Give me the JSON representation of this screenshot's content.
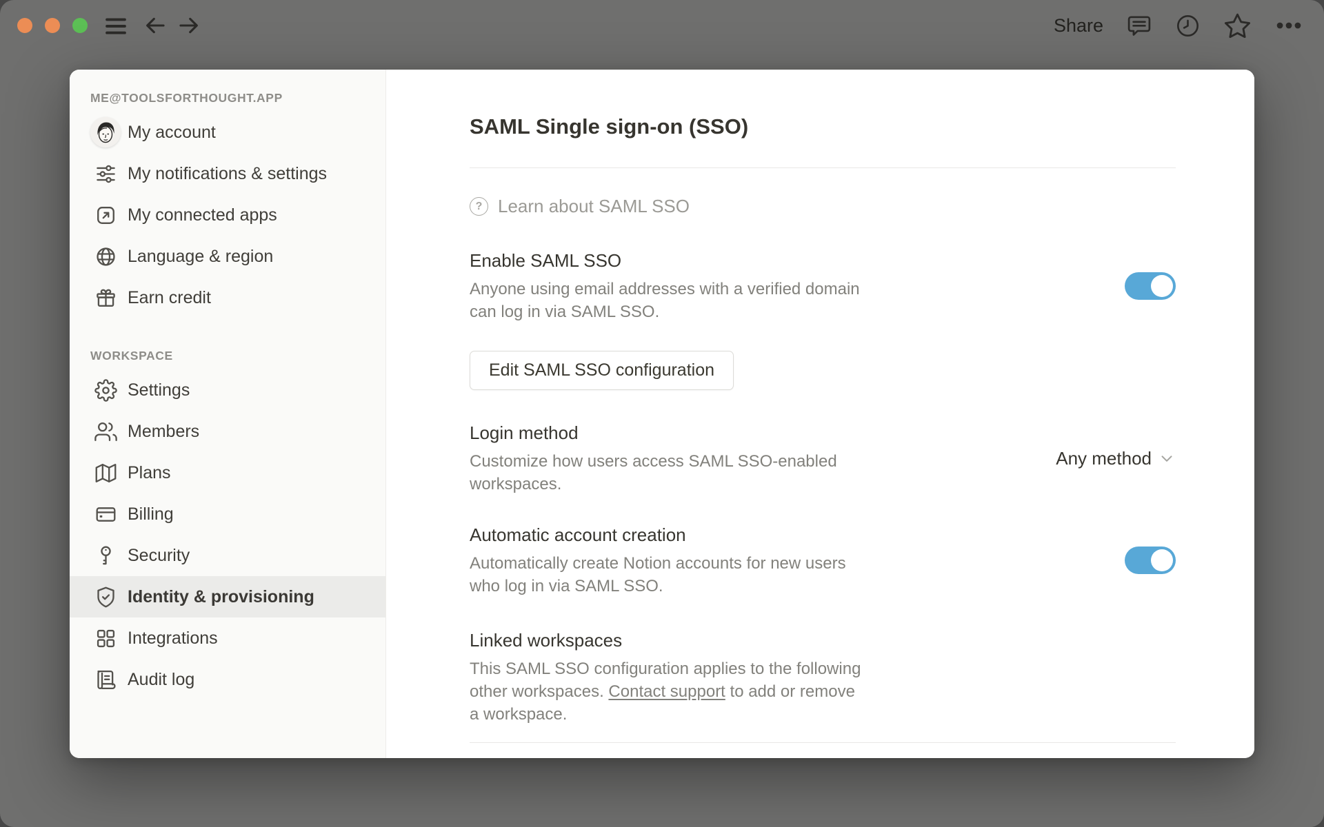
{
  "titlebar": {
    "share_label": "Share",
    "icons": {
      "traffic_close": "circle",
      "traffic_minimize": "circle",
      "traffic_zoom": "circle",
      "menu": "hamburger-lines",
      "back": "arrow-left",
      "forward": "arrow-right",
      "comments": "speech-bubble",
      "updates": "clock",
      "favorite": "star-outline",
      "more": "ellipsis"
    }
  },
  "sidebar": {
    "account_header": "ME@TOOLSFORTHOUGHT.APP",
    "account_items": [
      {
        "icon": "avatar-photo",
        "label": "My account"
      },
      {
        "icon": "sliders",
        "label": "My notifications & settings"
      },
      {
        "icon": "arrow-up-right-box",
        "label": "My connected apps"
      },
      {
        "icon": "globe",
        "label": "Language & region"
      },
      {
        "icon": "gift",
        "label": "Earn credit"
      }
    ],
    "workspace_header": "WORKSPACE",
    "workspace_items": [
      {
        "icon": "gear",
        "label": "Settings"
      },
      {
        "icon": "people",
        "label": "Members"
      },
      {
        "icon": "map",
        "label": "Plans"
      },
      {
        "icon": "credit-card",
        "label": "Billing"
      },
      {
        "icon": "key",
        "label": "Security"
      },
      {
        "icon": "shield-check",
        "label": "Identity & provisioning",
        "selected": true
      },
      {
        "icon": "grid-squares",
        "label": "Integrations"
      },
      {
        "icon": "scroll",
        "label": "Audit log"
      }
    ]
  },
  "main": {
    "title": "SAML Single sign-on (SSO)",
    "learn_icon_glyph": "?",
    "learn_link": "Learn about SAML SSO",
    "enable": {
      "heading": "Enable SAML SSO",
      "description": "Anyone using email addresses with a verified domain\ncan log in via SAML SSO.",
      "toggle_on": true
    },
    "edit_button_label": "Edit SAML SSO configuration",
    "login_method": {
      "heading": "Login method",
      "description": "Customize how users access SAML SSO-enabled\nworkspaces.",
      "selected_value": "Any method"
    },
    "auto_account": {
      "heading": "Automatic account creation",
      "description": "Automatically create Notion accounts for new users\nwho log in via SAML SSO.",
      "toggle_on": true
    },
    "linked": {
      "heading": "Linked workspaces",
      "description_before": "This SAML SSO configuration applies to the following\nother workspaces. ",
      "link_text": "Contact support",
      "description_after": " to add or remove\na workspace."
    }
  },
  "colors": {
    "window_chrome_gray": "#6F6F6E",
    "traffic_light_close": "#EC8D55",
    "traffic_light_minimize": "#EC8D55",
    "traffic_light_zoom": "#5CBF55",
    "toggle_on_blue": "#58A8D7",
    "sidebar_bg": "#FAFAF8",
    "selected_item_bg": "#EBEBE9",
    "primary_text": "#37352F",
    "secondary_text": "#82817C"
  }
}
